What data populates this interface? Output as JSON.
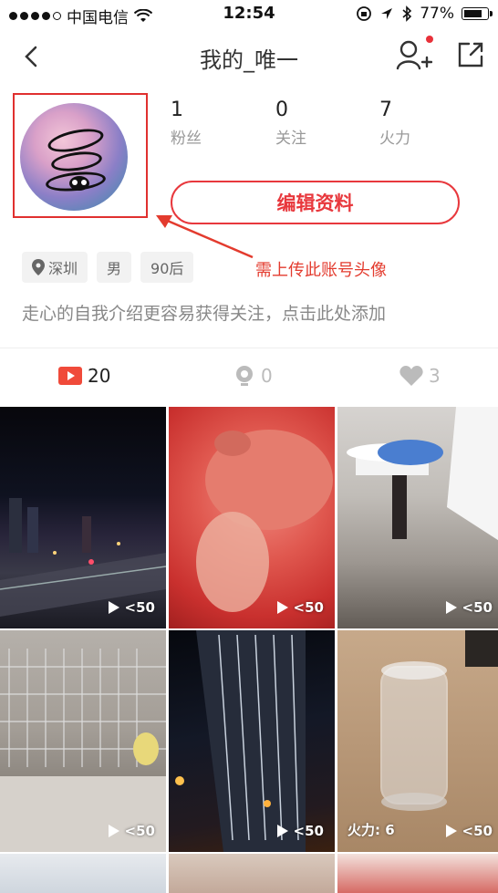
{
  "status_bar": {
    "carrier": "中国电信",
    "time": "12:54",
    "battery": "77%"
  },
  "nav": {
    "title": "我的_唯一"
  },
  "profile": {
    "stats": [
      {
        "value": "1",
        "label": "粉丝"
      },
      {
        "value": "0",
        "label": "关注"
      },
      {
        "value": "7",
        "label": "火力"
      }
    ],
    "edit_label": "编辑资料",
    "annotation": "需上传此账号头像",
    "tags": {
      "location": "深圳",
      "gender": "男",
      "age": "90后"
    },
    "bio_placeholder": "走心的自我介绍更容易获得关注，点击此处添加"
  },
  "tabs": [
    {
      "count": "20"
    },
    {
      "count": "0"
    },
    {
      "count": "3"
    }
  ],
  "videos": [
    {
      "plays": "<50"
    },
    {
      "plays": "<50"
    },
    {
      "plays": "<50"
    },
    {
      "plays": "<50"
    },
    {
      "plays": "<50"
    },
    {
      "plays": "<50",
      "heat": "火力: 6"
    }
  ],
  "colors": {
    "accent": "#e8383d",
    "annotation": "#e33b2e"
  }
}
